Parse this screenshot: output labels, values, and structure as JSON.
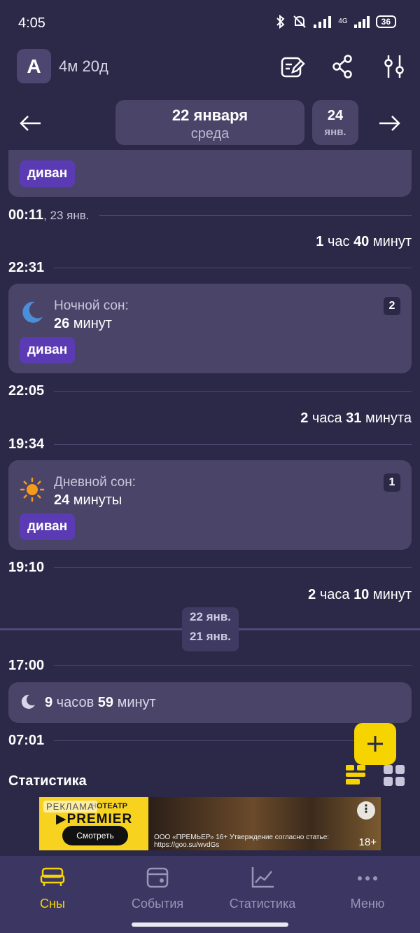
{
  "status_bar": {
    "time": "4:05",
    "network": "4G",
    "battery": "36"
  },
  "header": {
    "avatar_letter": "А",
    "age": "4м 20д"
  },
  "date_nav": {
    "current_date": "22 января",
    "current_weekday": "среда",
    "next_day": "24",
    "next_month": "янв."
  },
  "timeline": {
    "top_tag": "диван",
    "time_1": "00:11",
    "time_1_date": ", 23 янв.",
    "gap_1": {
      "n1": "1",
      "u1": " час ",
      "n2": "40",
      "u2": " минут"
    },
    "time_2": "22:31",
    "sleep_2": {
      "label": "Ночной сон:",
      "value_num": "26",
      "value_unit": " минут",
      "badge": "2",
      "tag": "диван"
    },
    "time_3": "22:05",
    "gap_2": {
      "n1": "2",
      "u1": " часа ",
      "n2": "31",
      "u2": " минута"
    },
    "time_4": "19:34",
    "sleep_1": {
      "label": "Дневной сон:",
      "value_num": "24",
      "value_unit": " минуты",
      "badge": "1",
      "tag": "диван"
    },
    "time_5": "19:10",
    "gap_3": {
      "n1": "2",
      "u1": " часа ",
      "n2": "10",
      "u2": " минут"
    },
    "day_chip_top": "22 янв.",
    "day_chip_bottom": "21 янв.",
    "time_6": "17:00",
    "night_sleep": {
      "n1": "9",
      "u1": " часов ",
      "n2": "59",
      "u2": " минут"
    },
    "time_7": "07:01"
  },
  "stats_title": "Статистика",
  "ad": {
    "tag": "РЕКЛАМА",
    "brand_small": "НОТЕАТР",
    "brand": "▶PREMIER",
    "button": "Смотреть",
    "legal": "ООО «ПРЕМЬЕР» 16+ Утверждение согласно статье: https://goo.su/wvdGs",
    "age": "18+"
  },
  "bottom_nav": {
    "items": [
      {
        "label": "Сны"
      },
      {
        "label": "События"
      },
      {
        "label": "Статистика"
      },
      {
        "label": "Меню"
      }
    ]
  },
  "colors": {
    "background": "#2c2847",
    "card": "#4a4468",
    "tag": "#5b3bb3",
    "accent": "#f5d400"
  }
}
